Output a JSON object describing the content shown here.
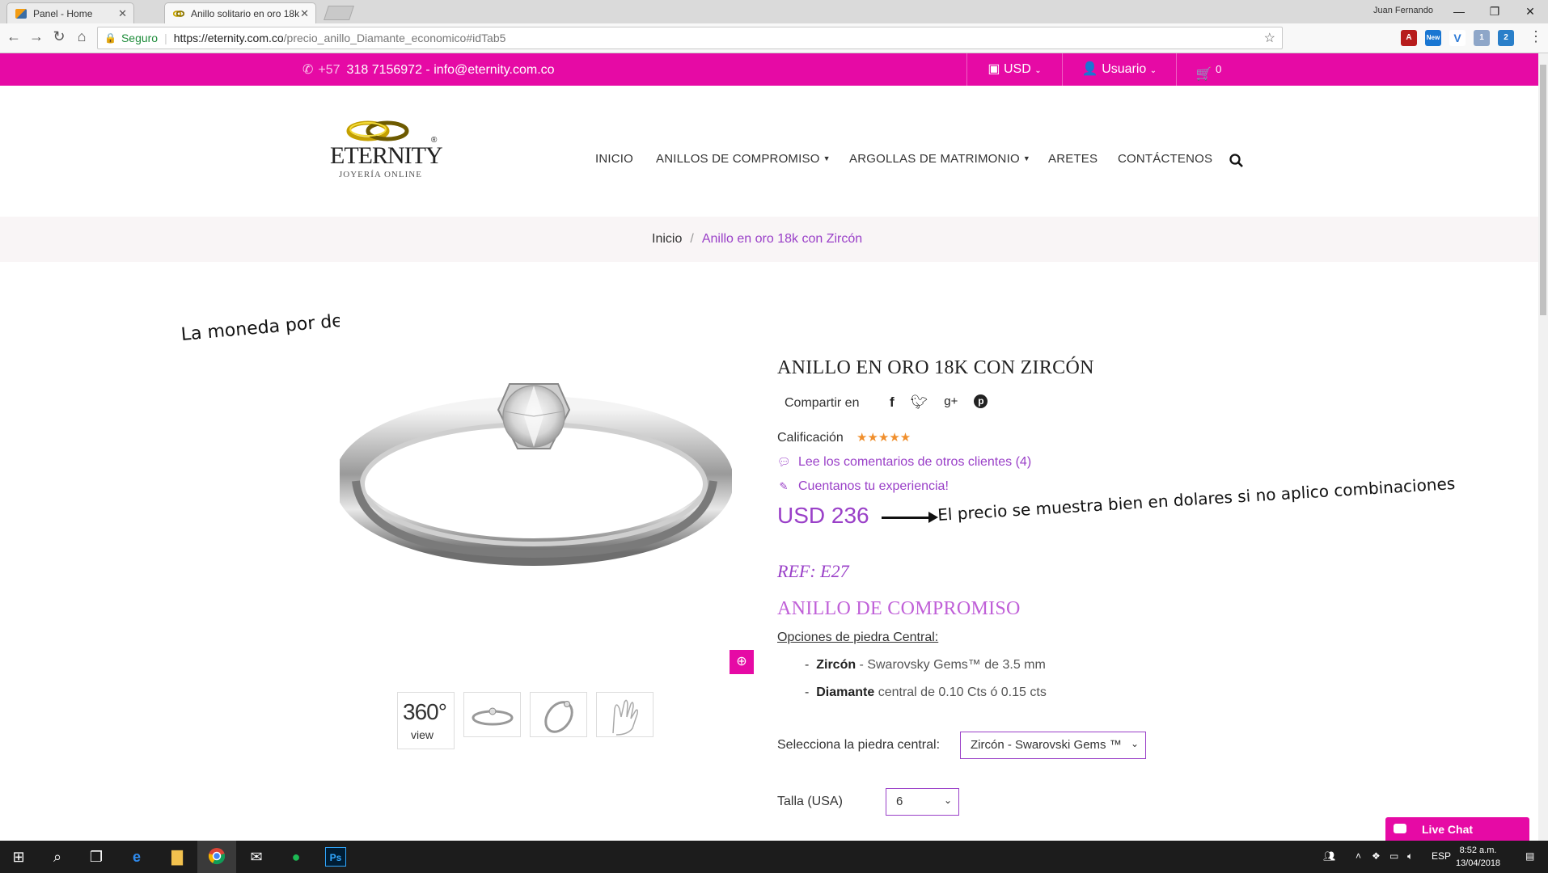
{
  "browser": {
    "tabs": [
      {
        "title": "Panel - Home",
        "close": "✕"
      },
      {
        "title": "Anillo solitario en oro 18k",
        "close": "✕"
      }
    ],
    "profile_name": "Juan Fernando",
    "window_controls": {
      "minimize": "—",
      "restore": "❐",
      "close": "✕"
    },
    "secure_label": "Seguro",
    "url_host": "https://eternity.com.co",
    "url_path": "/precio_anillo_Diamante_economico#idTab5",
    "extensions": [
      {
        "name": "pdf-extension-icon",
        "color": "#c62828"
      },
      {
        "name": "new-extension-icon",
        "label": "New",
        "color": "#1976d2"
      },
      {
        "name": "v-extension-icon",
        "label": "V",
        "color": "#2e7bd6"
      },
      {
        "name": "stats-extension-icon",
        "label": "1",
        "color": "#8ea6c8"
      },
      {
        "name": "code-extension-icon",
        "label": "2",
        "color": "#2a7fc9"
      }
    ]
  },
  "topbar": {
    "phone_prefix": "+57",
    "phone_rest": "318 7156972 - info@eternity.com.co",
    "currency": "USD",
    "user": "Usuario",
    "cart_count": "0"
  },
  "logo": {
    "brand": "ETERNITY",
    "sub": "JOYERÍA ONLINE",
    "reg": "®"
  },
  "menu": [
    "INICIO",
    "ANILLOS DE COMPROMISO",
    "ARGOLLAS DE MATRIMONIO",
    "ARETES",
    "CONTÁCTENOS"
  ],
  "breadcrumb": {
    "home": "Inicio",
    "separator": "/",
    "current": "Anillo en oro 18k con Zircón"
  },
  "annotations": {
    "currency_note": "La moneda por defecto es peso colombiano",
    "price_note": "El precio se muestra bien en dolares si no aplico combinaciones"
  },
  "gallery": {
    "view360_big": "360°",
    "view360_small": "view"
  },
  "product": {
    "title": "ANILLO EN ORO 18K CON ZIRCÓN",
    "share_label": "Compartir en",
    "rating_label": "Calificación",
    "rating_stars": "★★★★★",
    "reviews_link": "Lee los comentarios de otros clientes (4)",
    "experience_link": "Cuentanos tu experiencia!",
    "price": "USD 236",
    "ref": "REF: E27",
    "category": "ANILLO DE COMPROMISO",
    "options_title": "Opciones de piedra Central:",
    "options": [
      {
        "dash": "-",
        "name": "Zircón",
        "detail": " - Swarovsky Gems™ de 3.5 mm"
      },
      {
        "dash": "-",
        "name": "Diamante",
        "detail": " central de 0.10 Cts ó 0.15 cts"
      }
    ],
    "stone_label": "Selecciona la piedra central:",
    "stone_value": "Zircón - Swarovski Gems ™",
    "size_label": "Talla (USA)",
    "size_value": "6"
  },
  "livechat": {
    "label": "Live Chat"
  },
  "taskbar": {
    "lang": "ESP",
    "time": "8:52 a.m.",
    "date": "13/04/2018"
  }
}
